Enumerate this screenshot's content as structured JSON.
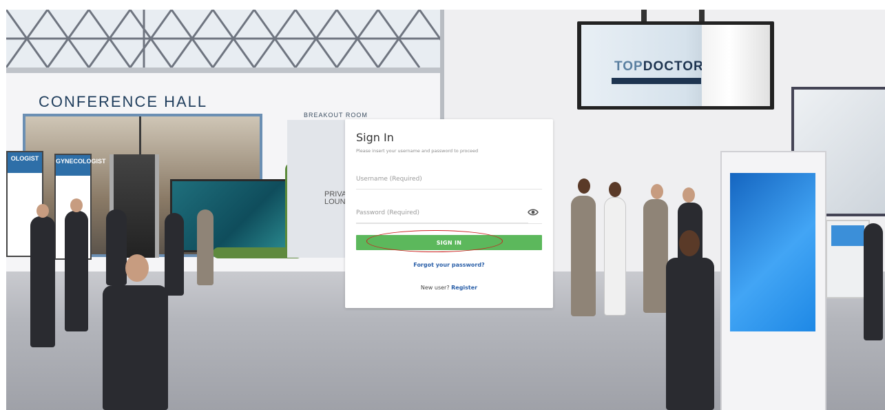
{
  "scene": {
    "conference_hall_label": "CONFERENCE HALL",
    "breakout_room_label": "BREAKOUT ROOM",
    "lounge_label": "PRIVATE LOUNGE",
    "poster_left_label": "OLOGIST",
    "poster_right_label": "GYNECOLOGIST",
    "tv_brand_strong": "TOP",
    "tv_brand_rest": "DOCTORS"
  },
  "login": {
    "title": "Sign In",
    "subtitle": "Please insert your username and password to proceed",
    "username_placeholder": "Username (Required)",
    "password_placeholder": "Password (Required)",
    "signin_label": "SIGN IN",
    "forgot_label": "Forgot your password?",
    "new_user_text": "New user?",
    "register_label": "Register"
  },
  "colors": {
    "primary_button": "#5cb85c",
    "link": "#2a5fa8",
    "highlight": "#cc1f1f"
  },
  "icons": {
    "password_toggle": "eye-icon"
  }
}
